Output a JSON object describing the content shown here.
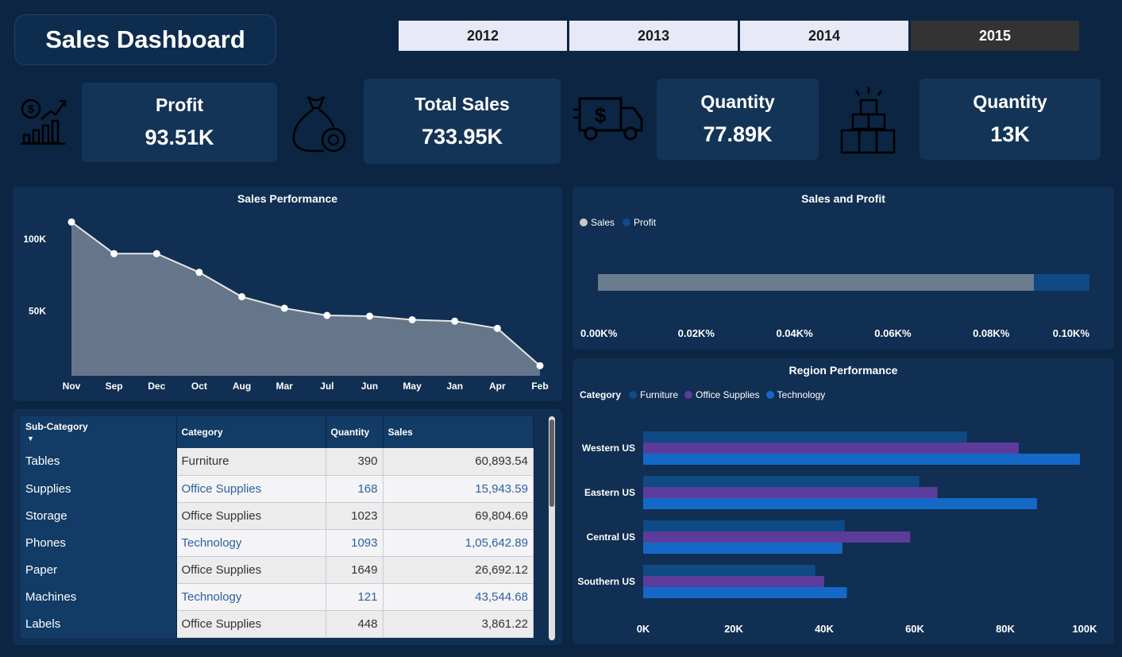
{
  "title": "Sales Dashboard",
  "years": [
    {
      "label": "2012",
      "active": false
    },
    {
      "label": "2013",
      "active": false
    },
    {
      "label": "2014",
      "active": false
    },
    {
      "label": "2015",
      "active": true
    }
  ],
  "kpis": [
    {
      "label": "Profit",
      "value": "93.51K",
      "icon": "profit-growth-icon"
    },
    {
      "label": "Total Sales",
      "value": "733.95K",
      "icon": "money-bag-icon"
    },
    {
      "label": "Quantity",
      "value": "77.89K",
      "icon": "delivery-truck-icon"
    },
    {
      "label": "Quantity",
      "value": "13K",
      "icon": "boxes-icon"
    }
  ],
  "colors": {
    "background": "#0b2543",
    "panel": "#102f52",
    "area_fill": "#66768a",
    "sales": "#6b7c8f",
    "profit": "#0f4a85",
    "furniture": "#0f4a85",
    "office_supplies": "#5b3c9a",
    "technology": "#1469c7"
  },
  "chart_data": [
    {
      "type": "area",
      "title": "Sales Performance",
      "categories": [
        "Nov",
        "Sep",
        "Dec",
        "Oct",
        "Aug",
        "Mar",
        "Jul",
        "Jun",
        "May",
        "Jan",
        "Apr",
        "Feb"
      ],
      "values": [
        112000,
        90000,
        90000,
        77000,
        60000,
        52000,
        47000,
        46500,
        44000,
        43000,
        38000,
        12000
      ],
      "y_ticks": [
        {
          "label": "100K",
          "value": 100000
        },
        {
          "label": "50K",
          "value": 50000
        }
      ],
      "ylim": [
        5000,
        120000
      ],
      "grid": false
    },
    {
      "type": "bar",
      "orientation": "horizontal-stacked",
      "title": "Sales and Profit",
      "legend": [
        "Sales",
        "Profit"
      ],
      "legend_position": "top-left",
      "series": [
        {
          "name": "Sales",
          "values": [
            0.0887
          ]
        },
        {
          "name": "Profit",
          "values": [
            0.0113
          ]
        }
      ],
      "x_ticks": [
        "0.00K%",
        "0.02K%",
        "0.04K%",
        "0.06K%",
        "0.08K%",
        "0.10K%"
      ],
      "xlim": [
        0,
        0.1
      ]
    },
    {
      "type": "bar",
      "orientation": "horizontal",
      "title": "Region Performance",
      "legend_title": "Category",
      "legend_position": "top-left",
      "categories": [
        "Western US",
        "Eastern US",
        "Central US",
        "Southern US"
      ],
      "series": [
        {
          "name": "Furniture",
          "values": [
            71500,
            61000,
            44500,
            38000
          ]
        },
        {
          "name": "Office Supplies",
          "values": [
            83000,
            65000,
            59000,
            40000
          ]
        },
        {
          "name": "Technology",
          "values": [
            96500,
            87000,
            44000,
            45000
          ]
        }
      ],
      "x_ticks": [
        "0K",
        "20K",
        "40K",
        "60K",
        "80K",
        "100K"
      ],
      "xlim": [
        0,
        100000
      ]
    }
  ],
  "table": {
    "headers": [
      "Sub-Category",
      "Category",
      "Quantity",
      "Sales"
    ],
    "rows": [
      [
        "Tables",
        "Furniture",
        "390",
        "60,893.54"
      ],
      [
        "Supplies",
        "Office Supplies",
        "168",
        "15,943.59"
      ],
      [
        "Storage",
        "Office Supplies",
        "1023",
        "69,804.69"
      ],
      [
        "Phones",
        "Technology",
        "1093",
        "1,05,642.89"
      ],
      [
        "Paper",
        "Office Supplies",
        "1649",
        "26,692.12"
      ],
      [
        "Machines",
        "Technology",
        "121",
        "43,544.68"
      ],
      [
        "Labels",
        "Office Supplies",
        "448",
        "3,861.22"
      ]
    ]
  }
}
